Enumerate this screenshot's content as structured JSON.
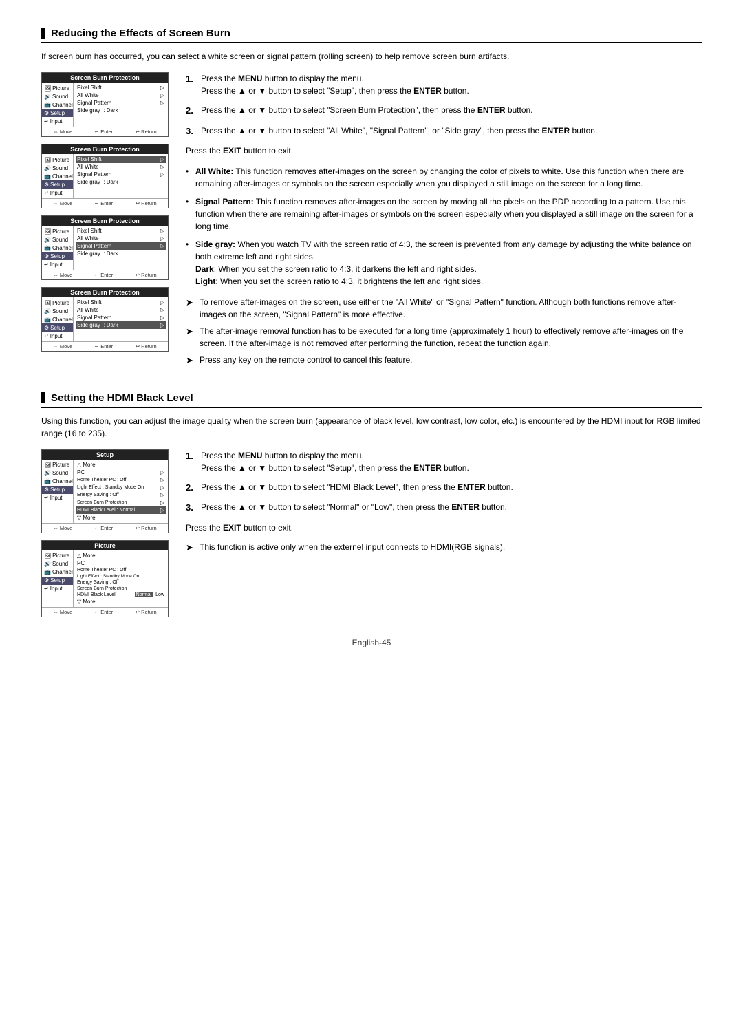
{
  "sections": [
    {
      "id": "screen-burn",
      "title": "Reducing the Effects of Screen Burn",
      "intro": "If screen burn has occurred, you can select a white screen or signal pattern (rolling screen) to help remove screen burn artifacts.",
      "steps": [
        {
          "num": "1.",
          "text": "Press the <b>MENU</b> button to display the menu.\nPress the ▲ or ▼ button to select \"Setup\", then press the <b>ENTER</b> button."
        },
        {
          "num": "2.",
          "text": "Press the ▲ or ▼ button to select \"Screen Burn Protection\", then press the <b>ENTER</b> button."
        },
        {
          "num": "3.",
          "text": "Press the ▲ or ▼ button to select \"All White\", \"Signal Pattern\", or \"Side gray\", then press the <b>ENTER</b> button."
        }
      ],
      "exit_note": "Press the <b>EXIT</b> button to exit.",
      "bullets": [
        {
          "label": "All White:",
          "text": "This function removes after-images on the screen by changing the color of pixels to white. Use this function when there are remaining after-images or symbols on the screen especially when you displayed a still image on the screen for a long time."
        },
        {
          "label": "Signal Pattern:",
          "text": "This function removes after-images on the screen by moving all the pixels on the PDP according to a pattern. Use this function when there are remaining after-images or symbols on the screen especially when you displayed a still image on the screen for a long time."
        },
        {
          "label": "Side gray:",
          "text": "When you watch TV with the screen ratio of 4:3, the screen is prevented from any damage by adjusting the white balance on both extreme left and right sides.\nDark: When you set the screen ratio to 4:3, it darkens the left and right sides.\nLight: When you set the screen ratio to 4:3, it brightens the left and right sides."
        }
      ],
      "tips": [
        "To remove after-images on the screen, use either the \"All White\" or \"Signal Pattern\" function. Although both functions remove after-images on the screen, \"Signal Pattern\" is more effective.",
        "The after-image removal function has to be executed for a long time (approximately 1 hour) to effectively remove after-images on the screen. If the after-image is not removed after performing the function, repeat the function again.",
        "Press any key on the remote control to cancel this feature."
      ],
      "screens": [
        {
          "header": "Screen Burn Protection",
          "sidebar": [
            "Picture",
            "Sound",
            "Channel",
            "Setup",
            "Input"
          ],
          "active_sidebar": "Setup",
          "items": [
            "Pixel Shift",
            "All White",
            "Signal Pattern",
            "Side gray  : Dark"
          ],
          "active_item": ""
        },
        {
          "header": "Screen Burn Protection",
          "sidebar": [
            "Picture",
            "Sound",
            "Channel",
            "Setup",
            "Input"
          ],
          "active_sidebar": "Setup",
          "items": [
            "Pixel Shift",
            "All White",
            "Signal Pattern",
            "Side gray  : Dark"
          ],
          "active_item": "Pixel Shift"
        },
        {
          "header": "Screen Burn Protection",
          "sidebar": [
            "Picture",
            "Sound",
            "Channel",
            "Setup",
            "Input"
          ],
          "active_sidebar": "Setup",
          "items": [
            "Pixel Shift",
            "All White",
            "Signal Pattern",
            "Side gray  : Dark"
          ],
          "active_item": "Signal Pattern"
        },
        {
          "header": "Screen Burn Protection",
          "sidebar": [
            "Picture",
            "Sound",
            "Channel",
            "Setup",
            "Input"
          ],
          "active_sidebar": "Setup",
          "items": [
            "Pixel Shift",
            "All White",
            "Signal Pattern",
            "Side gray  : Dark"
          ],
          "active_item": "Side gray  : Dark"
        }
      ]
    },
    {
      "id": "hdmi-black",
      "title": "Setting the HDMI Black Level",
      "intro": "Using this function, you can adjust the image quality when the screen burn (appearance of black level, low contrast, low color, etc.) is encountered by the HDMI input for RGB limited range (16 to 235).",
      "steps": [
        {
          "num": "1.",
          "text": "Press the <b>MENU</b> button to display the menu.\nPress the ▲ or ▼ button to select \"Setup\", then press the <b>ENTER</b> button."
        },
        {
          "num": "2.",
          "text": "Press the ▲ or ▼ button to select \"HDMI Black Level\", then press the <b>ENTER</b> button."
        },
        {
          "num": "3.",
          "text": "Press the ▲ or ▼ button to select \"Normal\" or \"Low\", then press the <b>ENTER</b> button."
        }
      ],
      "exit_note": "Press the <b>EXIT</b> button to exit.",
      "tips": [
        "This function is active only when the externel input connects to HDMI(RGB signals)."
      ],
      "screens": [
        {
          "header": "Setup",
          "sidebar": [
            "Picture",
            "Sound",
            "Channel",
            "Setup",
            "Input"
          ],
          "active_sidebar": "Setup",
          "items": [
            "△ More",
            "PC",
            "Home Theater PC  : Off",
            "Light Effect  : Standby Mode On",
            "Energy Saving  : Off",
            "Screen Burn Protection",
            "HDMI Black Level  : Normal",
            "▽ More"
          ],
          "active_item": "HDMI Black Level  : Normal"
        },
        {
          "header": "Picture",
          "sidebar": [
            "Picture",
            "Sound",
            "Channel",
            "Setup",
            "Input"
          ],
          "active_sidebar": "Setup",
          "items": [
            "△ More",
            "PC",
            "Home Theater PC  : Off",
            "Light Effect  : Standby Mode On",
            "Energy Saving  : Off",
            "Screen Burn Protection",
            "HDMI Black Level  Normal  Low",
            "▽ More"
          ],
          "active_item": "HDMI Black Level  Normal  Low"
        }
      ]
    }
  ],
  "footer": "English-45"
}
